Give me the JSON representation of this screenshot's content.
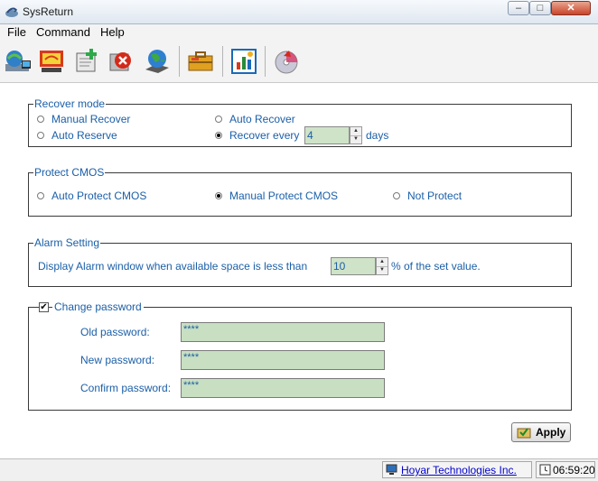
{
  "window": {
    "title": "SysReturn"
  },
  "menu": {
    "items": [
      "File",
      "Command",
      "Help"
    ]
  },
  "toolbar": {
    "buttons": [
      "network-icon",
      "return-arrow-icon",
      "add-document-icon",
      "delete-icon",
      "globe-install-icon",
      "briefcase-icon",
      "chart-report-icon",
      "disc-recover-icon"
    ]
  },
  "recover_mode": {
    "label": "Recover mode",
    "manual_recover": "Manual Recover",
    "auto_recover": "Auto Recover",
    "auto_reserve": "Auto Reserve",
    "recover_every": "Recover every",
    "days_value": "4",
    "days_label": "days",
    "selected": "recover_every"
  },
  "protect_cmos": {
    "label": "Protect CMOS",
    "auto": "Auto Protect CMOS",
    "manual": "Manual Protect CMOS",
    "none": "Not Protect",
    "selected": "manual"
  },
  "alarm": {
    "label": "Alarm Setting",
    "text_before": "Display Alarm window when available space is less than",
    "value": "10",
    "text_after": "% of the set value."
  },
  "password": {
    "checkbox_label": "Change password",
    "checked": true,
    "old_label": "Old password:",
    "new_label": "New password:",
    "confirm_label": "Confirm password:",
    "old_value": "****",
    "new_value": "****",
    "confirm_value": "****"
  },
  "apply_label": "Apply",
  "status": {
    "company": "Hoyar Technologies Inc.",
    "time": "06:59:20"
  }
}
